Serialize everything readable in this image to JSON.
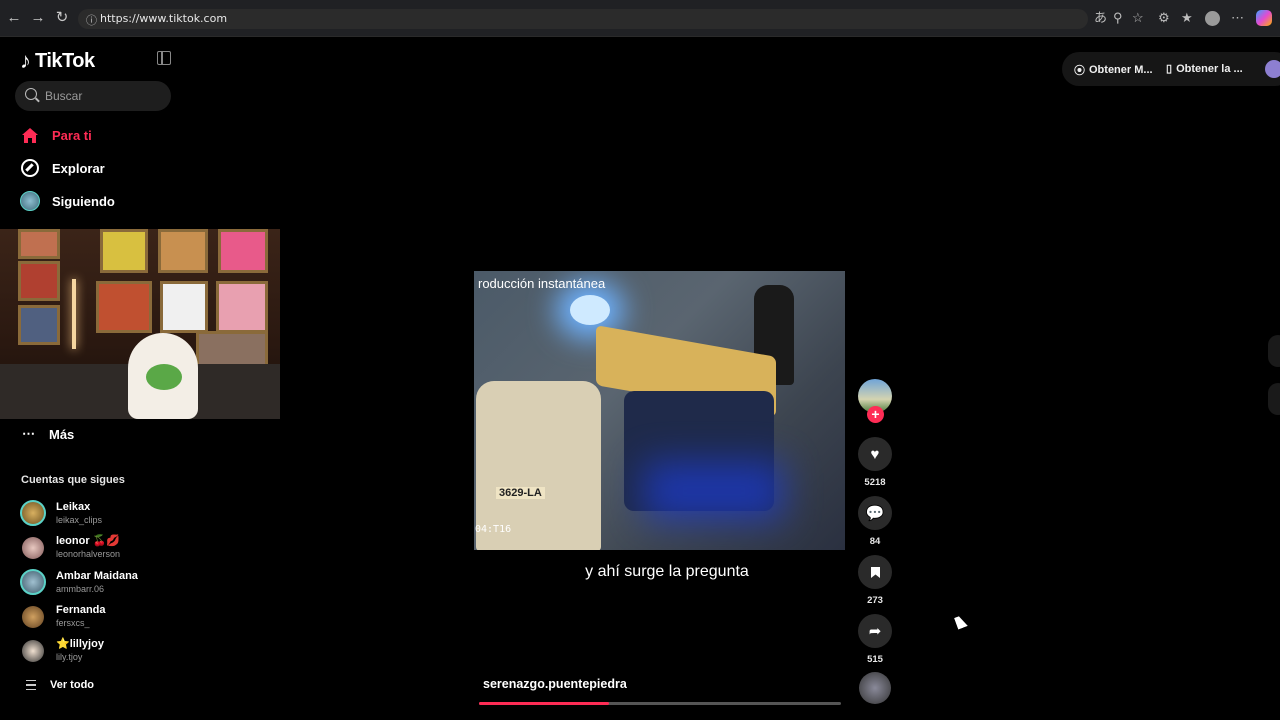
{
  "browser": {
    "url": "https://www.tiktok.com",
    "icons": [
      "back-icon",
      "forward-icon",
      "reload-icon",
      "translate-icon",
      "zoom-icon",
      "star-icon",
      "extensions-icon",
      "favorites-icon",
      "profile-icon",
      "more-icon",
      "copilot-icon"
    ]
  },
  "sidebar": {
    "brand": "TikTok",
    "search_placeholder": "Buscar",
    "nav": [
      {
        "label": "Para ti",
        "icon": "home-icon",
        "active": true
      },
      {
        "label": "Explorar",
        "icon": "compass-icon",
        "active": false
      },
      {
        "label": "Siguiendo",
        "icon": "following-avatar-icon",
        "active": false
      }
    ],
    "more_label": "Más",
    "following_title": "Cuentas que sigues",
    "accounts": [
      {
        "name": "Leikax",
        "handle": "leikax_clips"
      },
      {
        "name": "leonor 🍒💋",
        "handle": "leonorhalverson"
      },
      {
        "name": "Ambar Maidana",
        "handle": "ammbarr.06"
      },
      {
        "name": "Fernanda",
        "handle": "fersxcs_"
      },
      {
        "name": "⭐lillyjoy",
        "handle": "lily.tjoy"
      }
    ],
    "see_all": "Ver todo"
  },
  "top_actions": {
    "items": [
      "Obtener M...",
      "Obtener la ..."
    ]
  },
  "video": {
    "overlay_text": "roducción instantánea",
    "timestamp_text": "04:T16",
    "plate_text": "3629-LA",
    "caption": "y ahí surge la pregunta",
    "author": "serenazgo.puentepiedra",
    "progress_fraction": 0.36
  },
  "actions": {
    "likes": "5218",
    "comments": "84",
    "saves": "273",
    "shares": "515"
  },
  "colors": {
    "accent": "#fe2c55",
    "background": "#000000"
  }
}
